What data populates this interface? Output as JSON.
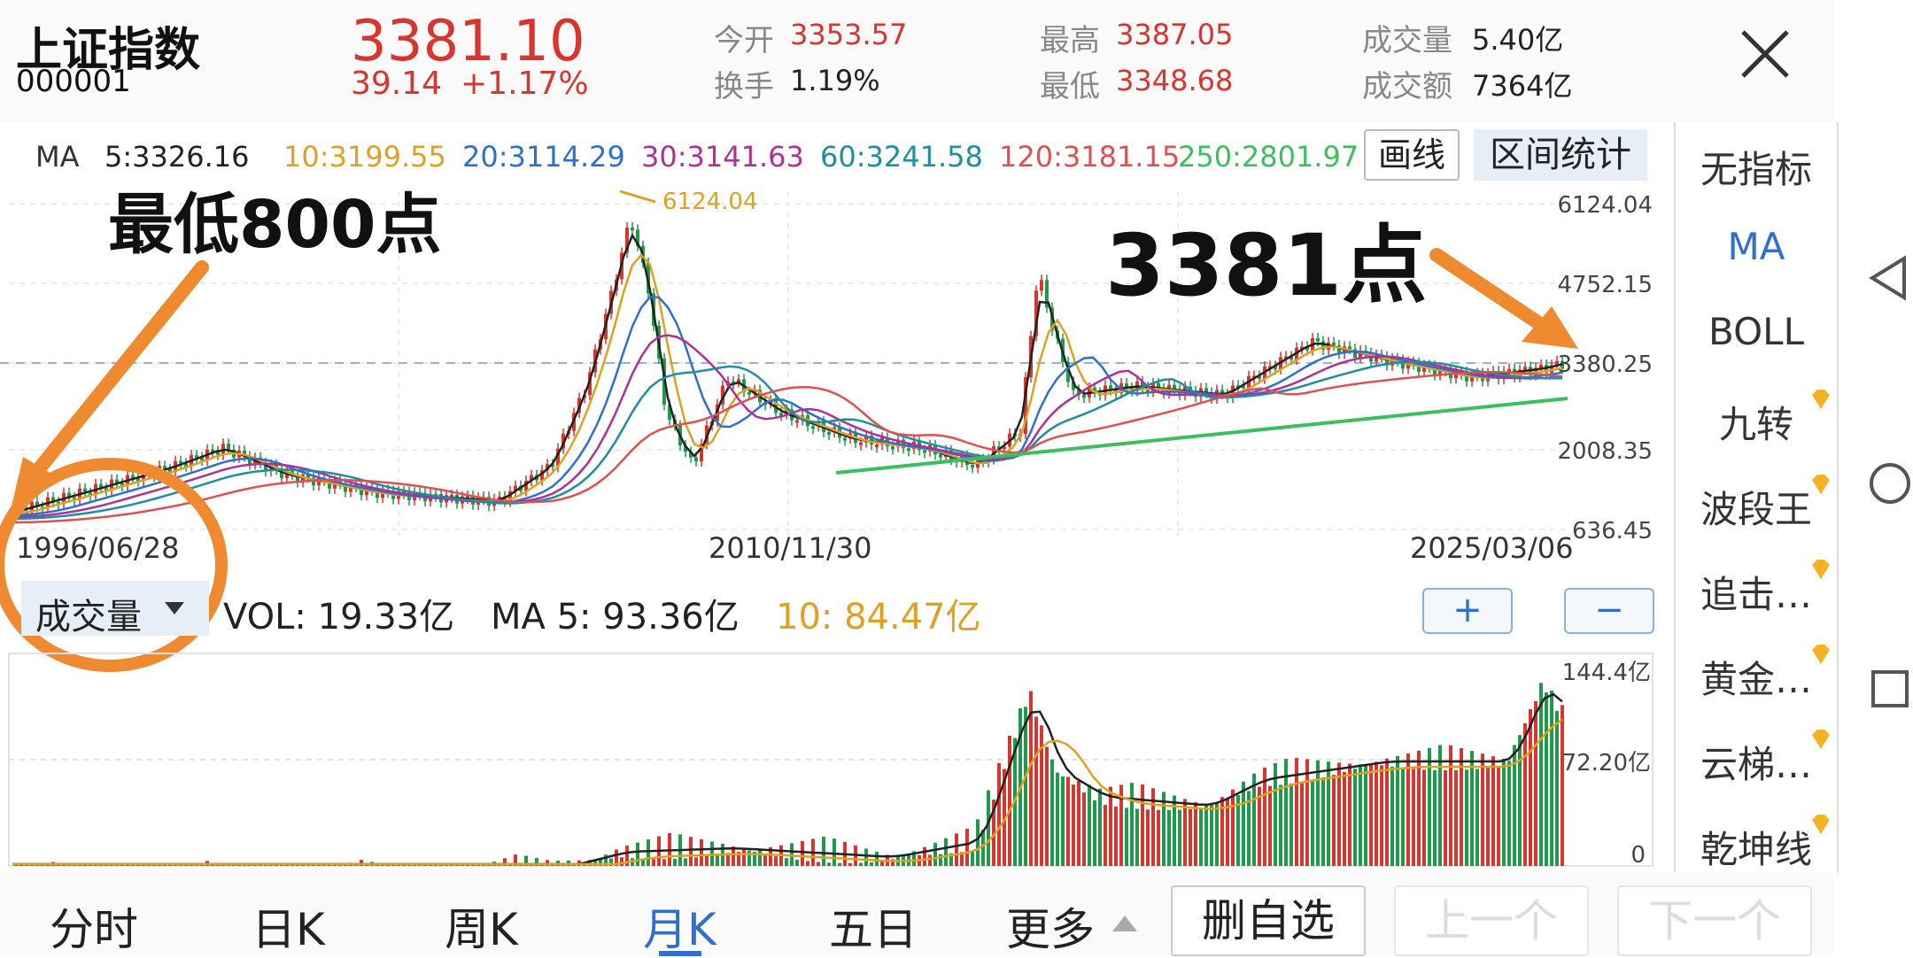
{
  "stock": {
    "name": "上证指数",
    "code": "000001",
    "price": "3381.10",
    "change": "39.14",
    "change_pct": "+1.17%"
  },
  "stats": {
    "open_label": "今开",
    "open": "3353.57",
    "turnover_label": "换手",
    "turnover": "1.19%",
    "high_label": "最高",
    "high": "3387.05",
    "low_label": "最低",
    "low": "3348.68",
    "volume_label": "成交量",
    "volume": "5.40亿",
    "amount_label": "成交额",
    "amount": "7364亿"
  },
  "ma_legend": {
    "label": "MA",
    "ma5": "5:3326.16",
    "ma10": "10:3199.55",
    "ma20": "20:3114.29",
    "ma30": "30:3141.63",
    "ma60": "60:3241.58",
    "ma120": "120:3181.15",
    "ma250": "250:2801.97"
  },
  "tools": {
    "draw_line": "画线",
    "range_stats": "区间统计"
  },
  "price_chart": {
    "y_axis": [
      "6124.04",
      "4752.15",
      "3380.25",
      "2008.35",
      "636.45"
    ],
    "dates": [
      "1996/06/28",
      "2010/11/30",
      "2025/03/06"
    ],
    "peak_label": "6124.04",
    "annotation_low": "最低800点",
    "annotation_current": "3381点"
  },
  "volume_bar": {
    "selector": "成交量",
    "vol": "VOL:  19.33亿",
    "ma5": "MA 5:  93.36亿",
    "ma10": "10:  84.47亿",
    "zoom_in": "+",
    "zoom_out": "−"
  },
  "volume_chart": {
    "y_axis": [
      "144.4亿",
      "72.20亿",
      "0"
    ]
  },
  "indicators": [
    "无指标",
    "MA",
    "BOLL",
    "九转",
    "波段王",
    "追击…",
    "黄金…",
    "云梯…",
    "乾坤线"
  ],
  "tabs": {
    "intraday": "分时",
    "day_k": "日K",
    "week_k": "周K",
    "month_k": "月K",
    "five_day": "五日",
    "more": "更多"
  },
  "actions": {
    "remove": "删自选",
    "prev": "上一个",
    "next": "下一个"
  },
  "colors": {
    "up": "#d8352f",
    "down": "#1e9a4b",
    "ma5": "#222222",
    "ma10": "#e0a020",
    "ma20": "#2f6fd0",
    "ma30": "#b0309a",
    "ma60": "#1d8fa0",
    "ma120": "#e05050",
    "ma250": "#3dbf5f",
    "annotation": "#f08a30",
    "accent": "#2f6fd0"
  }
}
